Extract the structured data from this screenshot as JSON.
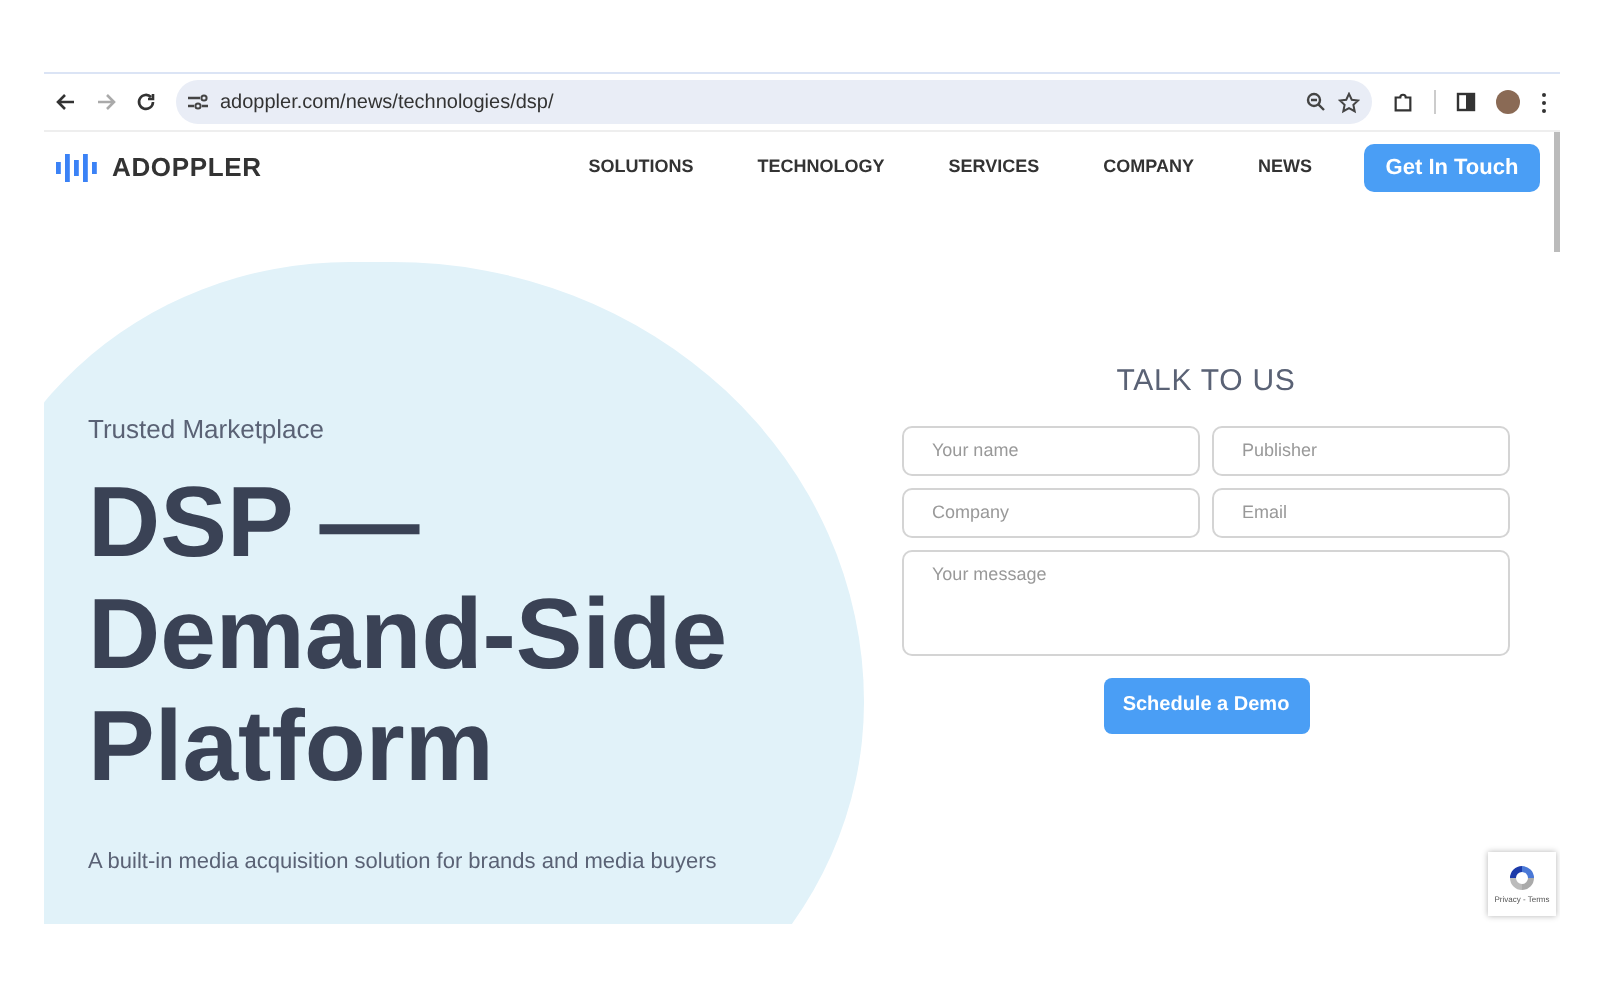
{
  "browser": {
    "url": "adoppler.com/news/technologies/dsp/"
  },
  "nav": {
    "logo": "ADOPPLER",
    "items": [
      {
        "label": "SOLUTIONS"
      },
      {
        "label": "TECHNOLOGY"
      },
      {
        "label": "SERVICES"
      },
      {
        "label": "COMPANY"
      },
      {
        "label": "NEWS"
      }
    ],
    "cta": "Get In Touch"
  },
  "hero": {
    "eyebrow": "Trusted Marketplace",
    "title": "DSP — Demand-Side Platform",
    "subtitle": "A built-in media acquisition solution for brands and media buyers"
  },
  "form": {
    "title": "TALK TO US",
    "fields": [
      {
        "placeholder": "Your name",
        "kind": "input"
      },
      {
        "placeholder": "Publisher",
        "kind": "input"
      },
      {
        "placeholder": "Company",
        "kind": "input"
      },
      {
        "placeholder": "Email",
        "kind": "input"
      },
      {
        "placeholder": "Your message",
        "kind": "textarea"
      }
    ],
    "submit": "Schedule a Demo"
  },
  "recaptcha": {
    "text": "Privacy - Terms"
  }
}
